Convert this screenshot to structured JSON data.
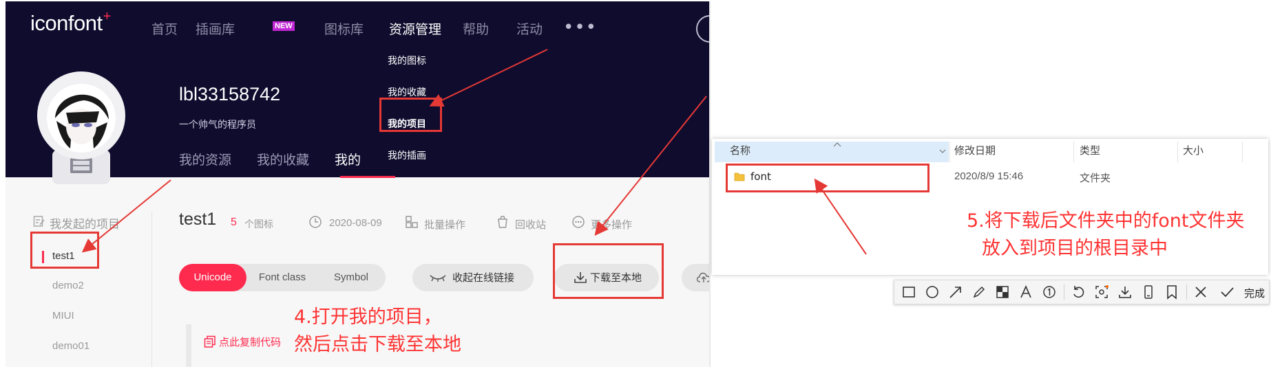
{
  "iconfont": {
    "logo_text": "iconfont",
    "logo_plus": "+",
    "nav": [
      {
        "label": "首页"
      },
      {
        "label": "插画库"
      },
      {
        "label": "图标库"
      },
      {
        "label": "资源管理"
      },
      {
        "label": "帮助"
      },
      {
        "label": "活动"
      }
    ],
    "nav_badge": "NEW",
    "nav_more": "•••",
    "resource_menu": [
      {
        "label": "我的图标"
      },
      {
        "label": "我的收藏"
      },
      {
        "label": "我的项目"
      },
      {
        "label": "我的插画"
      }
    ],
    "user": {
      "name": "lbl33158742",
      "bio": "一个帅气的程序员"
    },
    "user_tabs": [
      {
        "label": "我的资源"
      },
      {
        "label": "我的收藏"
      },
      {
        "label": "我的"
      }
    ],
    "sidebar": {
      "heading": "我发起的项目",
      "items": [
        {
          "label": "test1"
        },
        {
          "label": "demo2"
        },
        {
          "label": "MIUI"
        },
        {
          "label": "demo01"
        }
      ]
    },
    "project": {
      "name": "test1",
      "icon_count": "5",
      "icon_count_unit": "个图标",
      "date": "2020-08-09",
      "batch_label": "批量操作",
      "recycle_label": "回收站",
      "more_label": "更多操作"
    },
    "format_tabs": [
      {
        "label": "Unicode"
      },
      {
        "label": "Font class"
      },
      {
        "label": "Symbol"
      }
    ],
    "collapse_link_label": "收起在线链接",
    "download_label": "下载至本地",
    "copy_code_label": "点此复制代码",
    "annotation_4": [
      "4.打开我的项目，",
      "然后点击下载至本地"
    ]
  },
  "explorer": {
    "columns": [
      {
        "label": "名称"
      },
      {
        "label": "修改日期"
      },
      {
        "label": "类型"
      },
      {
        "label": "大小"
      }
    ],
    "rows": [
      {
        "name": "font",
        "modified": "2020/8/9 15:46",
        "type": "文件夹",
        "size": ""
      }
    ],
    "annotation_5": [
      "5.将下载后文件夹中的font文件夹",
      "放入到项目的根目录中"
    ]
  },
  "snap_toolbar": {
    "tools": [
      "rectangle-icon",
      "ellipse-icon",
      "arrow-icon",
      "pen-icon",
      "mosaic-icon",
      "text-icon",
      "number-icon",
      "undo-icon",
      "pin-icon",
      "save-icon",
      "phone-icon",
      "bookmark-icon",
      "close-icon",
      "check-icon"
    ],
    "done_label": "完成"
  },
  "colors": {
    "hero_bg": "#100c2e",
    "accent": "#ff2b4f",
    "annotation_red": "#ff3333"
  }
}
